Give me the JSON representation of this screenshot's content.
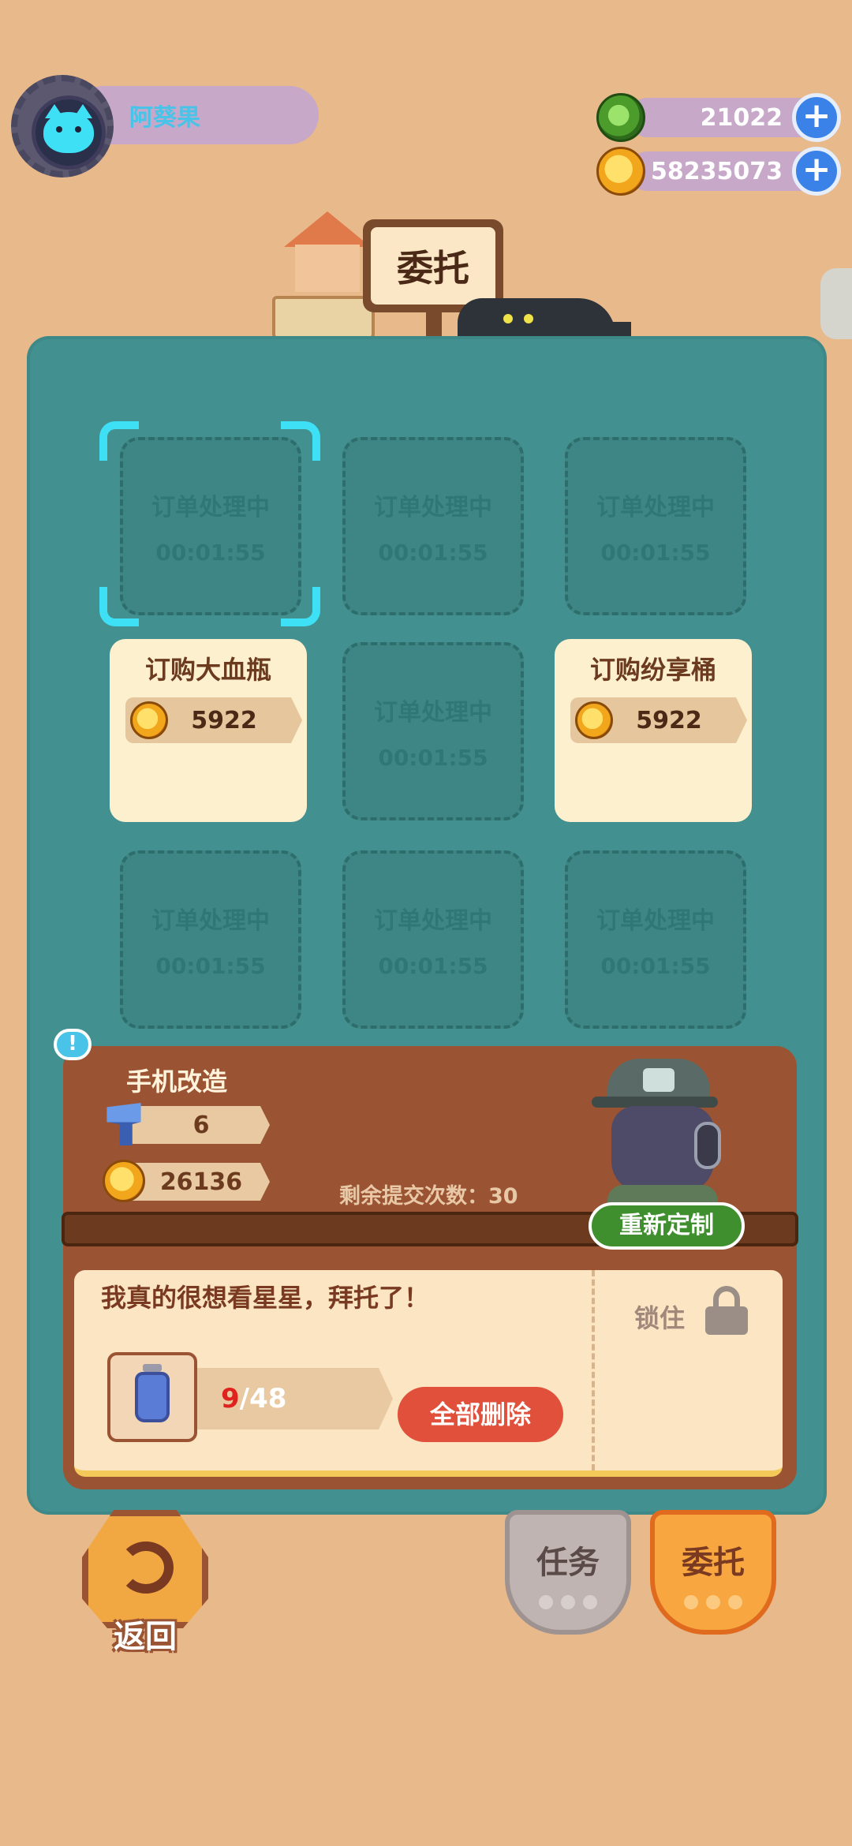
{
  "player": {
    "name": "阿葵果"
  },
  "currencies": [
    {
      "id": "gems",
      "value": "21022",
      "icon": "green-coin-icon"
    },
    {
      "id": "coins",
      "value": "58235073",
      "icon": "gold-coin-icon"
    }
  ],
  "title_sign": "委托",
  "grid": {
    "slots": [
      {
        "type": "processing",
        "label": "订单处理中",
        "timer": "00:01:55",
        "selected": true
      },
      {
        "type": "processing",
        "label": "订单处理中",
        "timer": "00:01:55"
      },
      {
        "type": "processing",
        "label": "订单处理中",
        "timer": "00:01:55"
      },
      {
        "type": "order",
        "label": "订购大血瓶",
        "price": "5922"
      },
      {
        "type": "processing",
        "label": "订单处理中",
        "timer": "00:01:55"
      },
      {
        "type": "order",
        "label": "订购纷享桶",
        "price": "5922"
      },
      {
        "type": "processing",
        "label": "订单处理中",
        "timer": "00:01:55"
      },
      {
        "type": "processing",
        "label": "订单处理中",
        "timer": "00:01:55"
      },
      {
        "type": "processing",
        "label": "订单处理中",
        "timer": "00:01:55"
      }
    ]
  },
  "commission": {
    "info_badge": "!",
    "title": "手机改造",
    "rewards": [
      {
        "icon": "screw-icon",
        "value": "6"
      },
      {
        "icon": "gold-coin-icon",
        "value": "26136"
      }
    ],
    "remaining_label": "剩余提交次数：30",
    "redo_label": "重新定制",
    "message": "我真的很想看星星，拜托了！",
    "item_icon": "star-jar-icon",
    "count_current": "9",
    "count_total": "/48",
    "delete_all_label": "全部删除",
    "lock_label": "锁住"
  },
  "bottom_nav": {
    "back_label": "返回",
    "task_label": "任务",
    "commission_label": "委托"
  },
  "colors": {
    "background": "#e8b98a",
    "panel": "#42908f",
    "selector": "#3ee0f5",
    "delete_button": "#e0503a",
    "redo_button": "#3f8f2e"
  }
}
